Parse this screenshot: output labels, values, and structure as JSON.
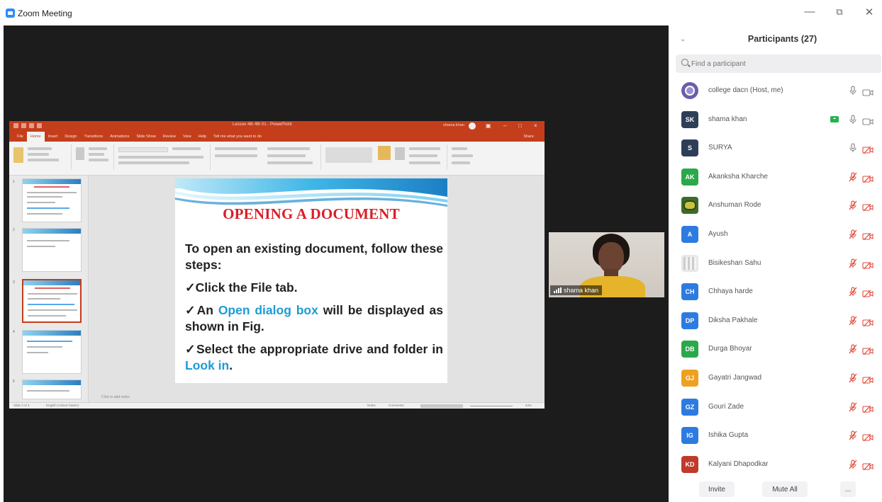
{
  "window": {
    "title": "Zoom Meeting",
    "minimize": "—",
    "restore": "⧉",
    "close": "✕"
  },
  "ppt": {
    "title": "Lesson 4th 4th 01 - PowerPoint",
    "account": "shama khan",
    "tabs": [
      "File",
      "Home",
      "Insert",
      "Design",
      "Transitions",
      "Animations",
      "Slide Show",
      "Review",
      "View",
      "Help",
      "Tell me what you want to do"
    ],
    "share": "Share",
    "notes_placeholder": "Click to add notes",
    "status_left": "Slide 3 of 4",
    "status_lang": "English (United States)",
    "status_notes": "Notes",
    "status_comments": "Comments",
    "zoom": "54%",
    "thumb_numbers": [
      "1",
      "2",
      "3",
      "4",
      "5"
    ]
  },
  "slide": {
    "title": "OPENING A DOCUMENT",
    "intro": "To open an existing document, follow these steps:",
    "step1": "✓Click the File tab.",
    "step2_pre": "✓An ",
    "step2_hl": "Open dialog box",
    "step2_post": " will be displayed as shown in Fig.",
    "step3_pre": "✓Select the appropriate drive and folder in ",
    "step3_hl": "Look in",
    "step3_post": "."
  },
  "camera": {
    "name": "shama khan"
  },
  "participants": {
    "title": "Participants (27)",
    "search_placeholder": "Find a participant",
    "items": [
      {
        "name": "college dacn (Host, me)",
        "initials": "",
        "color": "#6b5ea8",
        "mic": "on",
        "video": "off"
      },
      {
        "name": "shama khan",
        "initials": "SK",
        "color": "#2d3e57",
        "mic": "on",
        "video": "off",
        "sharing": true
      },
      {
        "name": "SURYA",
        "initials": "S",
        "color": "#2d3e57",
        "mic": "on",
        "video": "muted"
      },
      {
        "name": "Akanksha Kharche",
        "initials": "AK",
        "color": "#2ba84a",
        "mic": "muted",
        "video": "muted"
      },
      {
        "name": "Anshuman Rode",
        "initials": "",
        "color": "#3c6b2a",
        "mic": "muted",
        "video": "muted"
      },
      {
        "name": "Ayush",
        "initials": "A",
        "color": "#2d7be0",
        "mic": "muted",
        "video": "muted"
      },
      {
        "name": "Bisikeshan Sahu",
        "initials": "",
        "color": "#e8e8e8",
        "mic": "muted",
        "video": "muted"
      },
      {
        "name": "Chhaya harde",
        "initials": "CH",
        "color": "#2d7be0",
        "mic": "muted",
        "video": "muted"
      },
      {
        "name": "Diksha Pakhale",
        "initials": "DP",
        "color": "#2d7be0",
        "mic": "muted",
        "video": "muted"
      },
      {
        "name": "Durga Bhoyar",
        "initials": "DB",
        "color": "#2ba84a",
        "mic": "muted",
        "video": "muted"
      },
      {
        "name": "Gayatri Jangwad",
        "initials": "GJ",
        "color": "#f0a020",
        "mic": "muted",
        "video": "muted"
      },
      {
        "name": "Gouri Zade",
        "initials": "GZ",
        "color": "#2d7be0",
        "mic": "muted",
        "video": "muted"
      },
      {
        "name": "Ishika Gupta",
        "initials": "IG",
        "color": "#2d7be0",
        "mic": "muted",
        "video": "muted"
      },
      {
        "name": "Kalyani Dhapodkar",
        "initials": "KD",
        "color": "#c0392b",
        "mic": "muted",
        "video": "muted"
      }
    ],
    "invite": "Invite",
    "mute_all": "Mute All",
    "more": "..."
  }
}
